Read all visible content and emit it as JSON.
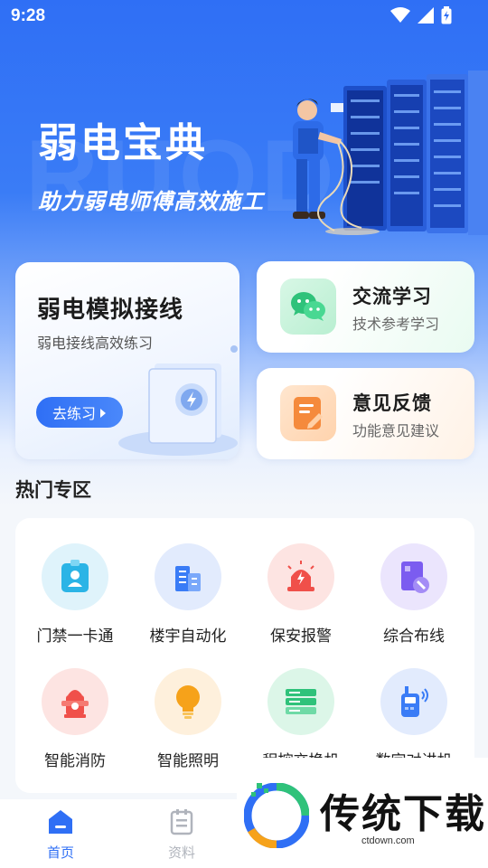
{
  "status": {
    "time": "9:28"
  },
  "hero": {
    "title": "弱电宝典",
    "subtitle": "助力弱电师傅高效施工",
    "watermark": "RUOD"
  },
  "cards": {
    "simulate": {
      "title": "弱电模拟接线",
      "subtitle": "弱电接线高效练习",
      "button": "去练习"
    },
    "exchange": {
      "title": "交流学习",
      "subtitle": "技术参考学习",
      "icon": "wechat-chat-icon"
    },
    "feedback": {
      "title": "意见反馈",
      "subtitle": "功能意见建议",
      "icon": "feedback-edit-icon"
    }
  },
  "hot": {
    "title": "热门专区",
    "items": [
      {
        "label": "门禁一卡通",
        "icon": "access-card-icon",
        "color": "#2bb4e6"
      },
      {
        "label": "楼宇自动化",
        "icon": "building-icon",
        "color": "#3a7cf6"
      },
      {
        "label": "保安报警",
        "icon": "alarm-siren-icon",
        "color": "#f0504a"
      },
      {
        "label": "综合布线",
        "icon": "cabling-tool-icon",
        "color": "#7b5cf0"
      },
      {
        "label": "智能消防",
        "icon": "fire-hydrant-icon",
        "color": "#f0504a"
      },
      {
        "label": "智能照明",
        "icon": "light-bulb-icon",
        "color": "#f6a21a"
      },
      {
        "label": "程控交换机",
        "icon": "server-switch-icon",
        "color": "#2fc27a"
      },
      {
        "label": "数字对讲机",
        "icon": "walkie-talkie-icon",
        "color": "#3a7cf6"
      }
    ]
  },
  "nav": {
    "home": "首页",
    "docs": "资料"
  },
  "overlay": {
    "brand": "传统下载",
    "url": "ctdown.com"
  },
  "colors": {
    "primary": "#2f6ff5",
    "nav_inactive": "#b0b4bc"
  }
}
